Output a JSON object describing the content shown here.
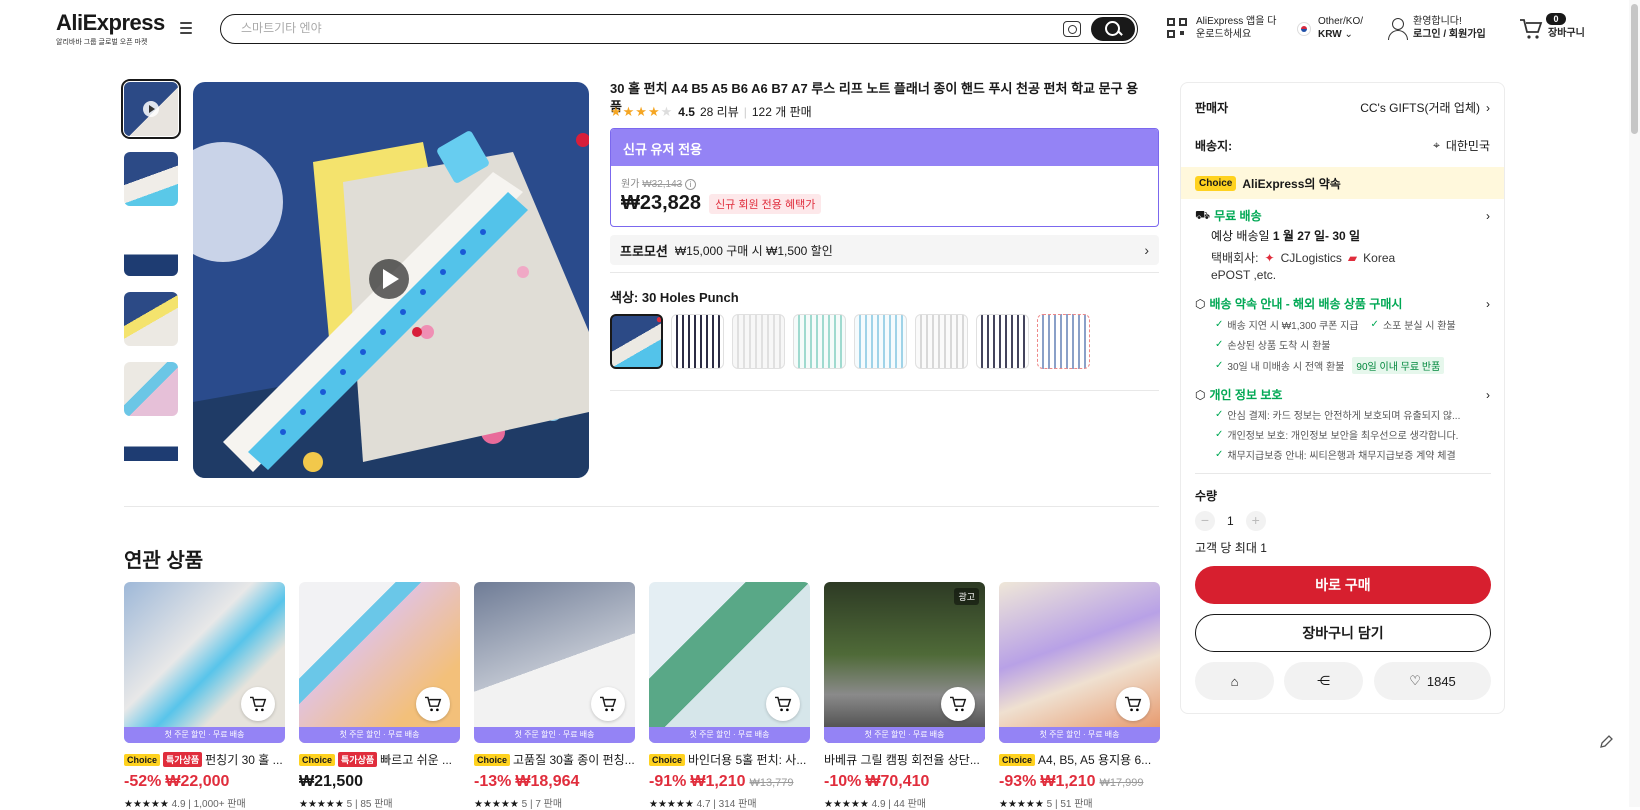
{
  "header": {
    "brand": "AliExpress",
    "tagline": "알리바바 그룹 글로벌 오픈 마켓",
    "search_placeholder": "스마트기타 엔야",
    "app_download_line1": "AliExpress 앱을 다",
    "app_download_line2": "운로드하세요",
    "region_line1": "Other/KO/",
    "region_line2": "KRW",
    "welcome_line1": "환영합니다!",
    "welcome_line2": "로그인 / 회원가입",
    "cart_count": "0",
    "cart_label": "장바구니"
  },
  "product": {
    "title": "30 홀 펀치 A4 B5 A5 B6 A6 B7 A7 루스 리프 노트 플래너 종이 핸드 푸시 천공 펀처 학교 문구 용품",
    "rating": "4.5",
    "reviews": "28 리뷰",
    "sold": "122 개 판매",
    "promo_header": "신규 유저 전용",
    "original_label": "원가",
    "original_price": "₩32,143",
    "price": "₩23,828",
    "new_badge": "신규 회원 전용 혜택가",
    "promotion_label": "프로모션",
    "promotion_text": "₩15,000 구매 시 ₩1,500 할인",
    "color_label": "색상: 30 Holes Punch"
  },
  "panel": {
    "seller_label": "판매자",
    "seller_value": "CC's GIFTS(거래 업체)",
    "ship_to_label": "배송지:",
    "ship_to_value": "대한민국",
    "choice_tag": "Choice",
    "choice_title": "AliExpress의 약속",
    "free_ship": "무료 배송",
    "eta_prefix": "예상 배송일",
    "eta_value": "1 월 27 일- 30 일",
    "carrier_label": "택배회사:",
    "carrier_1": "CJLogistics",
    "carrier_2": "Korea",
    "carrier_3": "ePOST ,etc.",
    "promise_title": "배송 약속 안내 - 해외 배송 상품 구매시",
    "promise_1": "배송 지연 시 ₩1,300 쿠폰 지급",
    "promise_2": "소포 분실 시 환불",
    "promise_3": "손상된 상품 도착 시 환불",
    "promise_4": "30일 내 미배송 시 전액 환불",
    "promise_badge": "90일 이내 무료 반품",
    "privacy_title": "개인 정보 보호",
    "privacy_1": "안심 결제: 카드 정보는 안전하게 보호되며 유출되지 않...",
    "privacy_2": "개인정보 보호: 개인정보 보안을 최우선으로 생각합니다.",
    "privacy_3": "채무지급보증 안내: 씨티은행과 채무지급보증 계약 체결",
    "qty_label": "수량",
    "qty_value": "1",
    "qty_limit": "고객 당 최대 1",
    "buy_now": "바로 구매",
    "add_cart": "장바구니 담기",
    "wishlist_count": "1845"
  },
  "related": {
    "title": "연관 상품",
    "strip_text": "첫 주문 할인 · 무료 배송",
    "ad_label": "광고",
    "items": [
      {
        "choice": "Choice",
        "hot": "특가상품",
        "name": "펀칭기 30 홀 ...",
        "discount": "-52%",
        "price": "₩22,000",
        "orig": "",
        "rating": "4.9 | 1,000+ 판매"
      },
      {
        "choice": "Choice",
        "hot": "특가상품",
        "name": "빠르고 쉬운 ...",
        "discount": "",
        "price": "₩21,500",
        "orig": "",
        "rating": "5 | 85 판매"
      },
      {
        "choice": "Choice",
        "hot": "",
        "name": "고품질 30홀 종이 펀칭...",
        "discount": "-13%",
        "price": "₩18,964",
        "orig": "",
        "rating": "5 | 7 판매"
      },
      {
        "choice": "Choice",
        "hot": "",
        "name": "바인더용 5홀 펀치: 사...",
        "discount": "-91%",
        "price": "₩1,210",
        "orig": "₩13,779",
        "rating": "4.7 | 314 판매"
      },
      {
        "choice": "",
        "hot": "",
        "name": "바베큐 그릴 캠핑 회전율 상단...",
        "discount": "-10%",
        "price": "₩70,410",
        "orig": "",
        "rating": "4.9 | 44 판매"
      },
      {
        "choice": "Choice",
        "hot": "",
        "name": "A4, B5, A5 용지용 6...",
        "discount": "-93%",
        "price": "₩1,210",
        "orig": "₩17,999",
        "rating": "5 | 51 판매"
      }
    ]
  },
  "colors": {
    "accent_purple": "#9483f5",
    "price_red": "#e02d3c",
    "buy_red": "#d71f2f",
    "choice_yellow": "#ffd21f",
    "green": "#00a854"
  }
}
